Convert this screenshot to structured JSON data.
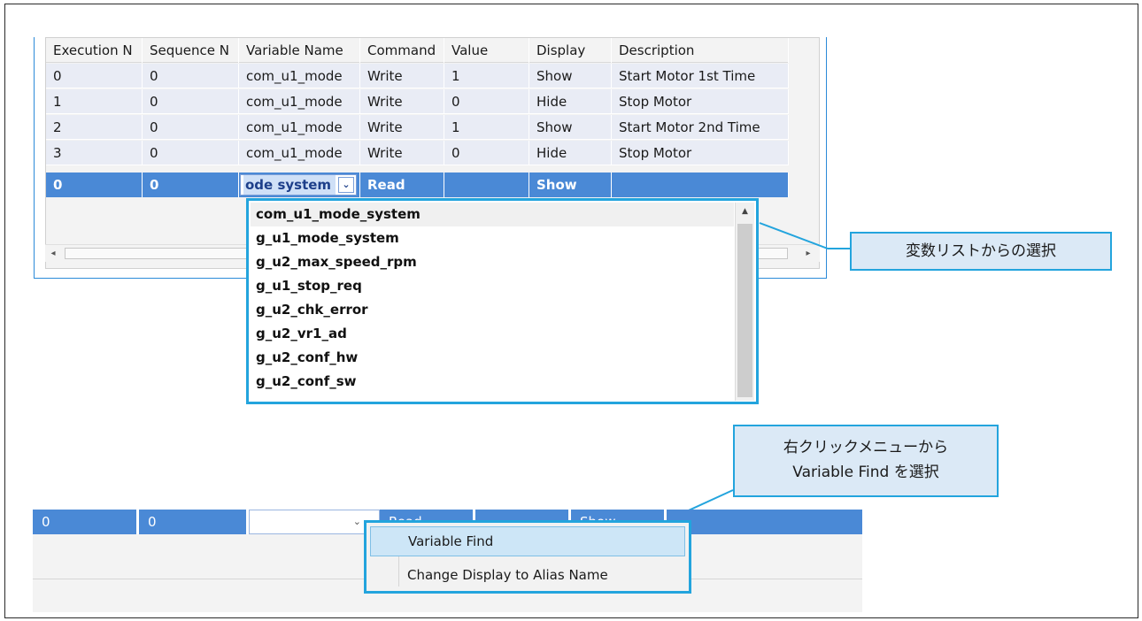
{
  "grid": {
    "columns": [
      "Execution N",
      "Sequence N",
      "Variable Name",
      "Command",
      "Value",
      "Display",
      "Description"
    ],
    "rows": [
      [
        "0",
        "0",
        "com_u1_mode",
        "Write",
        "1",
        "Show",
        "Start Motor 1st Time"
      ],
      [
        "1",
        "0",
        "com_u1_mode",
        "Write",
        "0",
        "Hide",
        "Stop Motor"
      ],
      [
        "2",
        "0",
        "com_u1_mode",
        "Write",
        "1",
        "Show",
        "Start Motor 2nd Time"
      ],
      [
        "3",
        "0",
        "com_u1_mode",
        "Write",
        "0",
        "Hide",
        "Stop Motor"
      ]
    ],
    "selected_row": {
      "execution": "0",
      "sequence": "0",
      "variable_editor_text": "ode system",
      "command": "Read",
      "value": "",
      "display": "Show",
      "description": ""
    },
    "combo_arrow_glyph": "⌄",
    "scroll_left_glyph": "◂",
    "scroll_right_glyph": "▸"
  },
  "variable_dropdown": {
    "items": [
      "com_u1_mode_system",
      "g_u1_mode_system",
      "g_u2_max_speed_rpm",
      "g_u1_stop_req",
      "g_u2_chk_error",
      "g_u2_vr1_ad",
      "g_u2_conf_hw",
      "g_u2_conf_sw"
    ],
    "scroll_up_glyph": "▲"
  },
  "callouts": {
    "select_from_list": "変数リストからの選択",
    "right_click_line1": "右クリックメニューから",
    "right_click_line2": "Variable Find を選択"
  },
  "bottom_row": {
    "execution": "0",
    "sequence": "0",
    "command_partial": "Read",
    "display_partial": "Show",
    "combo_arrow_glyph": "⌄"
  },
  "context_menu": {
    "items": [
      "Variable Find",
      "Change Display to Alias Name"
    ]
  },
  "colors": {
    "accent": "#23a4dd",
    "selection": "#4a89d6",
    "callout_fill": "#dbe9f6"
  }
}
